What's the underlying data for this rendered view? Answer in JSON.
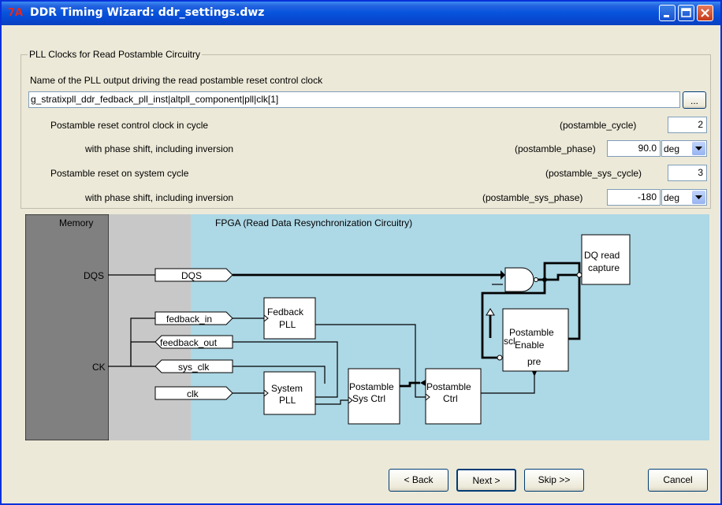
{
  "window": {
    "icon_text": "7A",
    "title": "DDR Timing Wizard: ddr_settings.dwz"
  },
  "group": {
    "legend": "PLL Clocks for Read Postamble Circuitry",
    "pll_output_label": "Name of the PLL output driving the read postamble reset control clock",
    "pll_output_value": "g_stratixpll_ddr_fedback_pll_inst|altpll_component|pll|clk[1]",
    "browse_label": "...",
    "rows": [
      {
        "label": "Postamble reset control clock in cycle",
        "param": "(postamble_cycle)",
        "value": "2"
      },
      {
        "label": "with phase shift, including inversion",
        "param": "(postamble_phase)",
        "value": "90.0",
        "unit": "deg"
      },
      {
        "label": "Postamble reset on system cycle",
        "param": "(postamble_sys_cycle)",
        "value": "3"
      },
      {
        "label": "with phase shift, including inversion",
        "param": "(postamble_sys_phase)",
        "value": "-180",
        "unit": "deg"
      }
    ]
  },
  "diagram": {
    "memory_label": "Memory",
    "fpga_label": "FPGA (Read Data Resynchronization Circuitry)",
    "pins": {
      "dqs": "DQS",
      "ck": "CK"
    },
    "signals": {
      "dqs": "DQS",
      "fedback_in": "fedback_in",
      "feedback_out": "feedback_out",
      "sys_clk": "sys_clk",
      "clk": "clk"
    },
    "blocks": {
      "fedback_pll": [
        "Fedback",
        "PLL"
      ],
      "system_pll": [
        "System",
        "PLL"
      ],
      "postamble_sys_ctrl": [
        "Postamble",
        "Sys Ctrl"
      ],
      "postamble_ctrl": [
        "Postamble",
        "Ctrl"
      ],
      "postamble_enable": [
        "Postamble",
        "Enable"
      ],
      "enable_scl": "scl",
      "enable_pre": "pre",
      "dq_capture": [
        "DQ read",
        "capture"
      ]
    },
    "colors": {
      "fpga_bg": "#add8e6",
      "memory_bg": "#808080",
      "interface_bg": "#c8c8c8"
    }
  },
  "buttons": {
    "back": "< Back",
    "next": "Next >",
    "skip": "Skip >>",
    "cancel": "Cancel"
  }
}
